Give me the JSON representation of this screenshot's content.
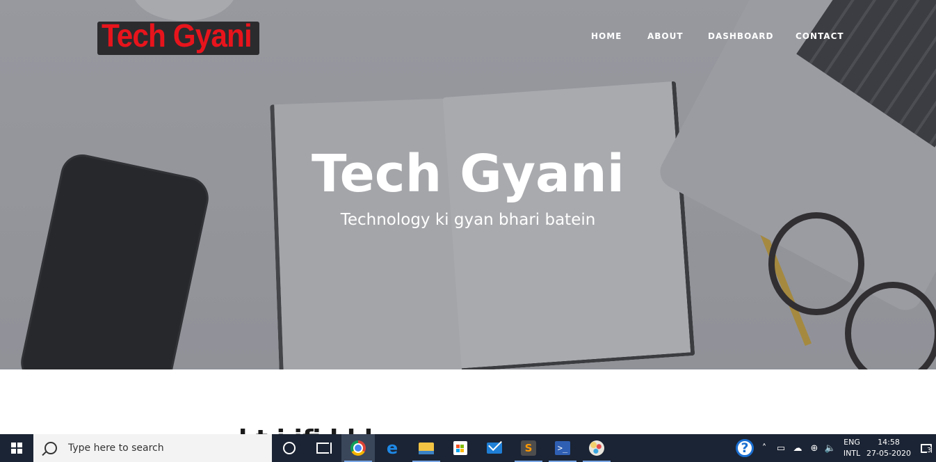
{
  "site": {
    "logo_text": "Tech Gyani",
    "nav": [
      "HOME",
      "ABOUT",
      "DASHBOARD",
      "CONTACT"
    ],
    "hero_title": "Tech Gyani",
    "hero_subtitle": "Technology ki gyan bhari batein",
    "content_heading_partial": "l  t  i  ifi  l  l  l"
  },
  "taskbar": {
    "search_placeholder": "Type here to search",
    "apps": [
      "chrome-icon",
      "edge-icon",
      "file-explorer-icon",
      "store-icon",
      "mail-icon",
      "sublime-text-icon",
      "powershell-icon",
      "paint-icon"
    ],
    "active_app": "chrome-icon",
    "tray": {
      "lang_primary": "ENG",
      "lang_secondary": "INTL",
      "time": "14:58",
      "date": "27-05-2020",
      "notification_count": "3"
    }
  }
}
